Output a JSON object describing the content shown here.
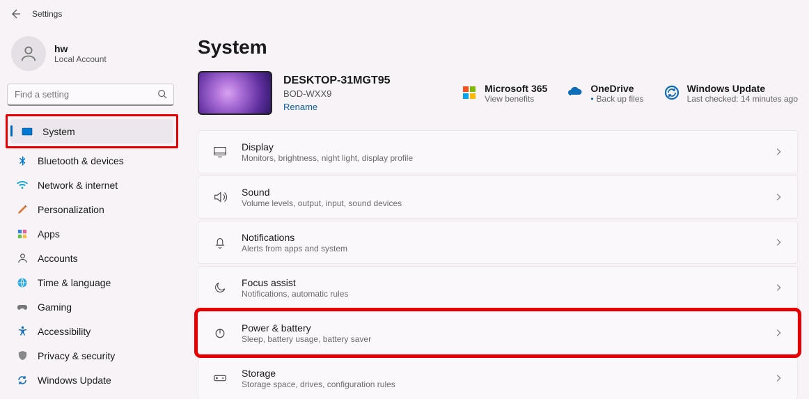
{
  "app": {
    "title": "Settings"
  },
  "account": {
    "name": "hw",
    "type": "Local Account"
  },
  "search": {
    "placeholder": "Find a setting"
  },
  "nav": {
    "system": "System",
    "bluetooth": "Bluetooth & devices",
    "network": "Network & internet",
    "personalization": "Personalization",
    "apps": "Apps",
    "accounts": "Accounts",
    "time": "Time & language",
    "gaming": "Gaming",
    "accessibility": "Accessibility",
    "privacy": "Privacy & security",
    "update": "Windows Update"
  },
  "page": {
    "title": "System",
    "device": {
      "name": "DESKTOP-31MGT95",
      "model": "BOD-WXX9",
      "rename": "Rename"
    },
    "status": {
      "m365": {
        "title": "Microsoft 365",
        "sub": "View benefits"
      },
      "onedrive": {
        "title": "OneDrive",
        "sub": "Back up files"
      },
      "update": {
        "title": "Windows Update",
        "sub": "Last checked: 14 minutes ago"
      }
    },
    "items": {
      "display": {
        "title": "Display",
        "sub": "Monitors, brightness, night light, display profile"
      },
      "sound": {
        "title": "Sound",
        "sub": "Volume levels, output, input, sound devices"
      },
      "notifications": {
        "title": "Notifications",
        "sub": "Alerts from apps and system"
      },
      "focus": {
        "title": "Focus assist",
        "sub": "Notifications, automatic rules"
      },
      "power": {
        "title": "Power & battery",
        "sub": "Sleep, battery usage, battery saver"
      },
      "storage": {
        "title": "Storage",
        "sub": "Storage space, drives, configuration rules"
      }
    }
  }
}
